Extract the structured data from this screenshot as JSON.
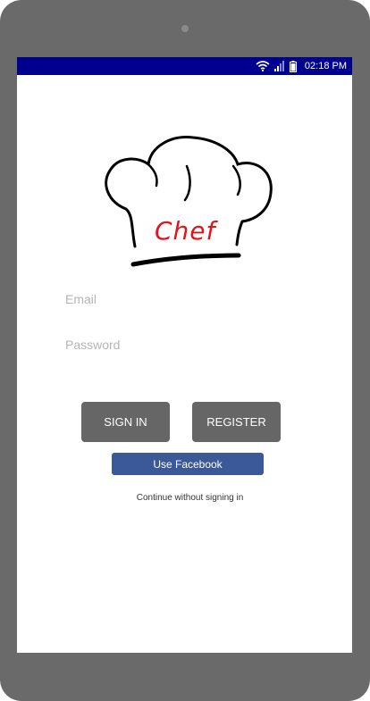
{
  "status_bar": {
    "time": "02:18 PM",
    "icons": [
      "wifi-icon",
      "signal-icon",
      "battery-icon"
    ],
    "background": "#00008f"
  },
  "logo": {
    "text": "Chef",
    "text_color": "#e1141b"
  },
  "form": {
    "email_placeholder": "Email",
    "email_value": "",
    "password_placeholder": "Password",
    "password_value": ""
  },
  "buttons": {
    "sign_in": "SIGN IN",
    "register": "REGISTER",
    "facebook": "Use Facebook"
  },
  "continue_link": "Continue without signing in",
  "colors": {
    "device_frame": "#6a6a6a",
    "button_gray": "#666666",
    "facebook_blue": "#3b5998"
  }
}
